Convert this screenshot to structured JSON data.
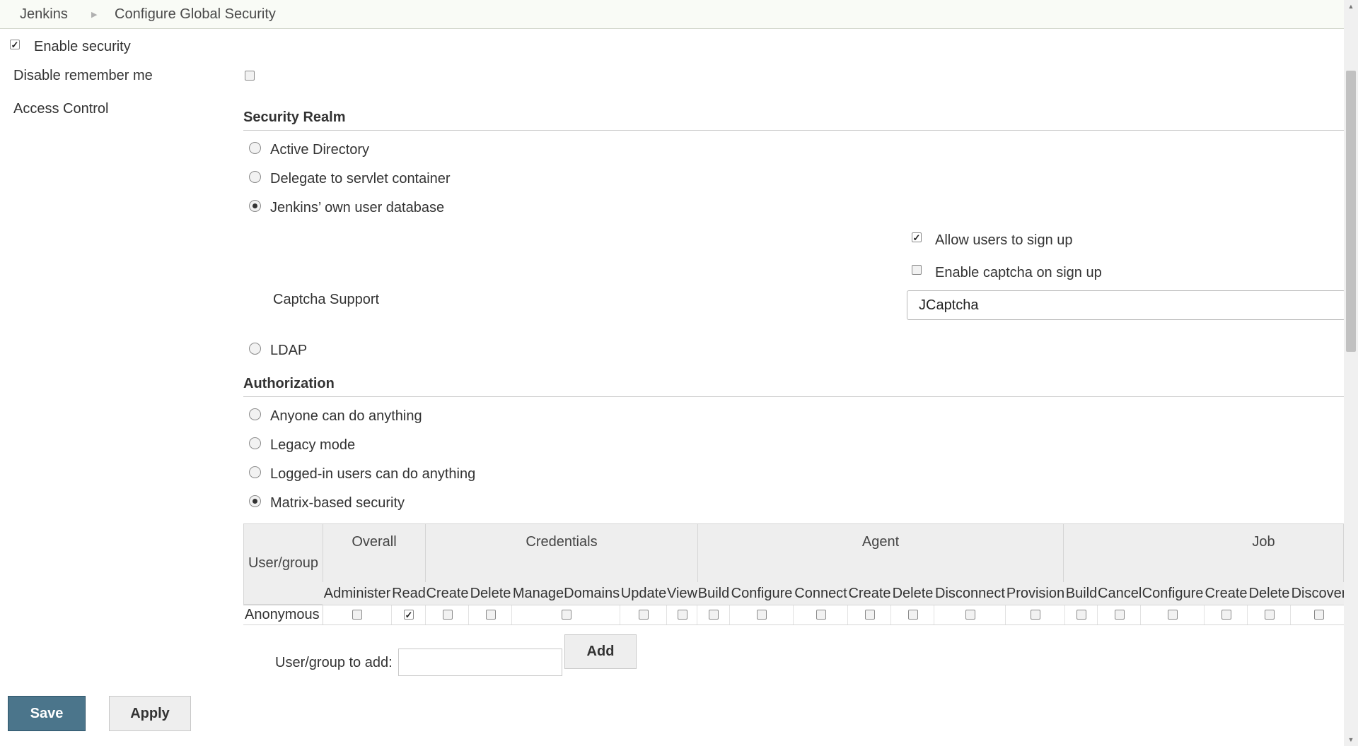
{
  "breadcrumb": {
    "home": "Jenkins",
    "current": "Configure Global Security"
  },
  "security": {
    "enable_security_label": "Enable security",
    "disable_remember_me_label": "Disable remember me",
    "access_control_label": "Access Control"
  },
  "security_realm": {
    "title": "Security Realm",
    "options": [
      "Active Directory",
      "Delegate to servlet container",
      "Jenkins’ own user database",
      "LDAP"
    ],
    "selected": "Jenkins’ own user database",
    "allow_signup_label": "Allow users to sign up",
    "captcha_on_signup_label": "Enable captcha on sign up",
    "captcha_support_label": "Captcha Support",
    "captcha_value": "JCaptcha"
  },
  "authorization": {
    "title": "Authorization",
    "options": [
      "Anyone can do anything",
      "Legacy mode",
      "Logged-in users can do anything",
      "Matrix-based security"
    ],
    "selected": "Matrix-based security"
  },
  "matrix": {
    "user_group_header": "User/group",
    "groups": [
      "Overall",
      "Credentials",
      "Agent",
      "Job"
    ],
    "columns": [
      "Administer",
      "Read",
      "Create",
      "Delete",
      "ManageDomains",
      "Update",
      "View",
      "Build",
      "Configure",
      "Connect",
      "Create",
      "Delete",
      "Disconnect",
      "Provision",
      "Build",
      "Cancel",
      "Configure",
      "Create",
      "Delete",
      "Discover"
    ],
    "rows": [
      {
        "name": "Anonymous",
        "checked": [
          false,
          true,
          false,
          false,
          false,
          false,
          false,
          false,
          false,
          false,
          false,
          false,
          false,
          false,
          false,
          false,
          false,
          false,
          false,
          false
        ]
      }
    ]
  },
  "add_user": {
    "label": "User/group to add:",
    "button": "Add"
  },
  "actions": {
    "save": "Save",
    "apply": "Apply"
  }
}
